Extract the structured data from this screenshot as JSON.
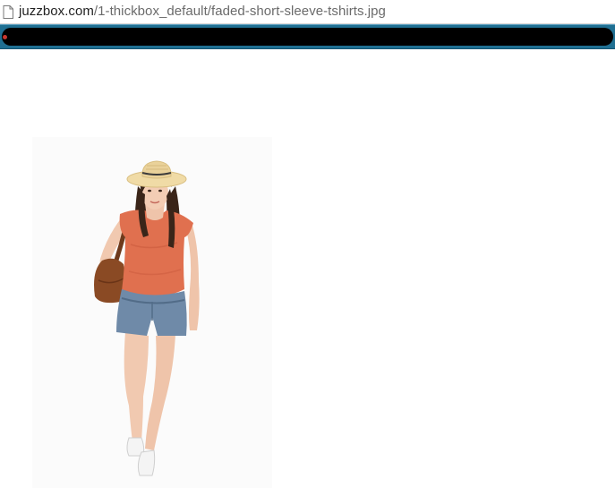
{
  "address_bar": {
    "url_domain": "juzzbox.com",
    "url_path": "/1-thickbox_default/faded-short-sleeve-tshirts.jpg",
    "page_icon": "document-icon"
  },
  "colors": {
    "page_background": "#ffffff",
    "info_bar": "#1f6f92",
    "redaction": "#000000",
    "shirt": "#e0704f",
    "shorts": "#6f8aa8",
    "hat": "#f0dba6",
    "bag": "#8a4a24"
  },
  "image": {
    "subject": "model-in-straw-hat-coral-tshirt-denim-shorts"
  }
}
